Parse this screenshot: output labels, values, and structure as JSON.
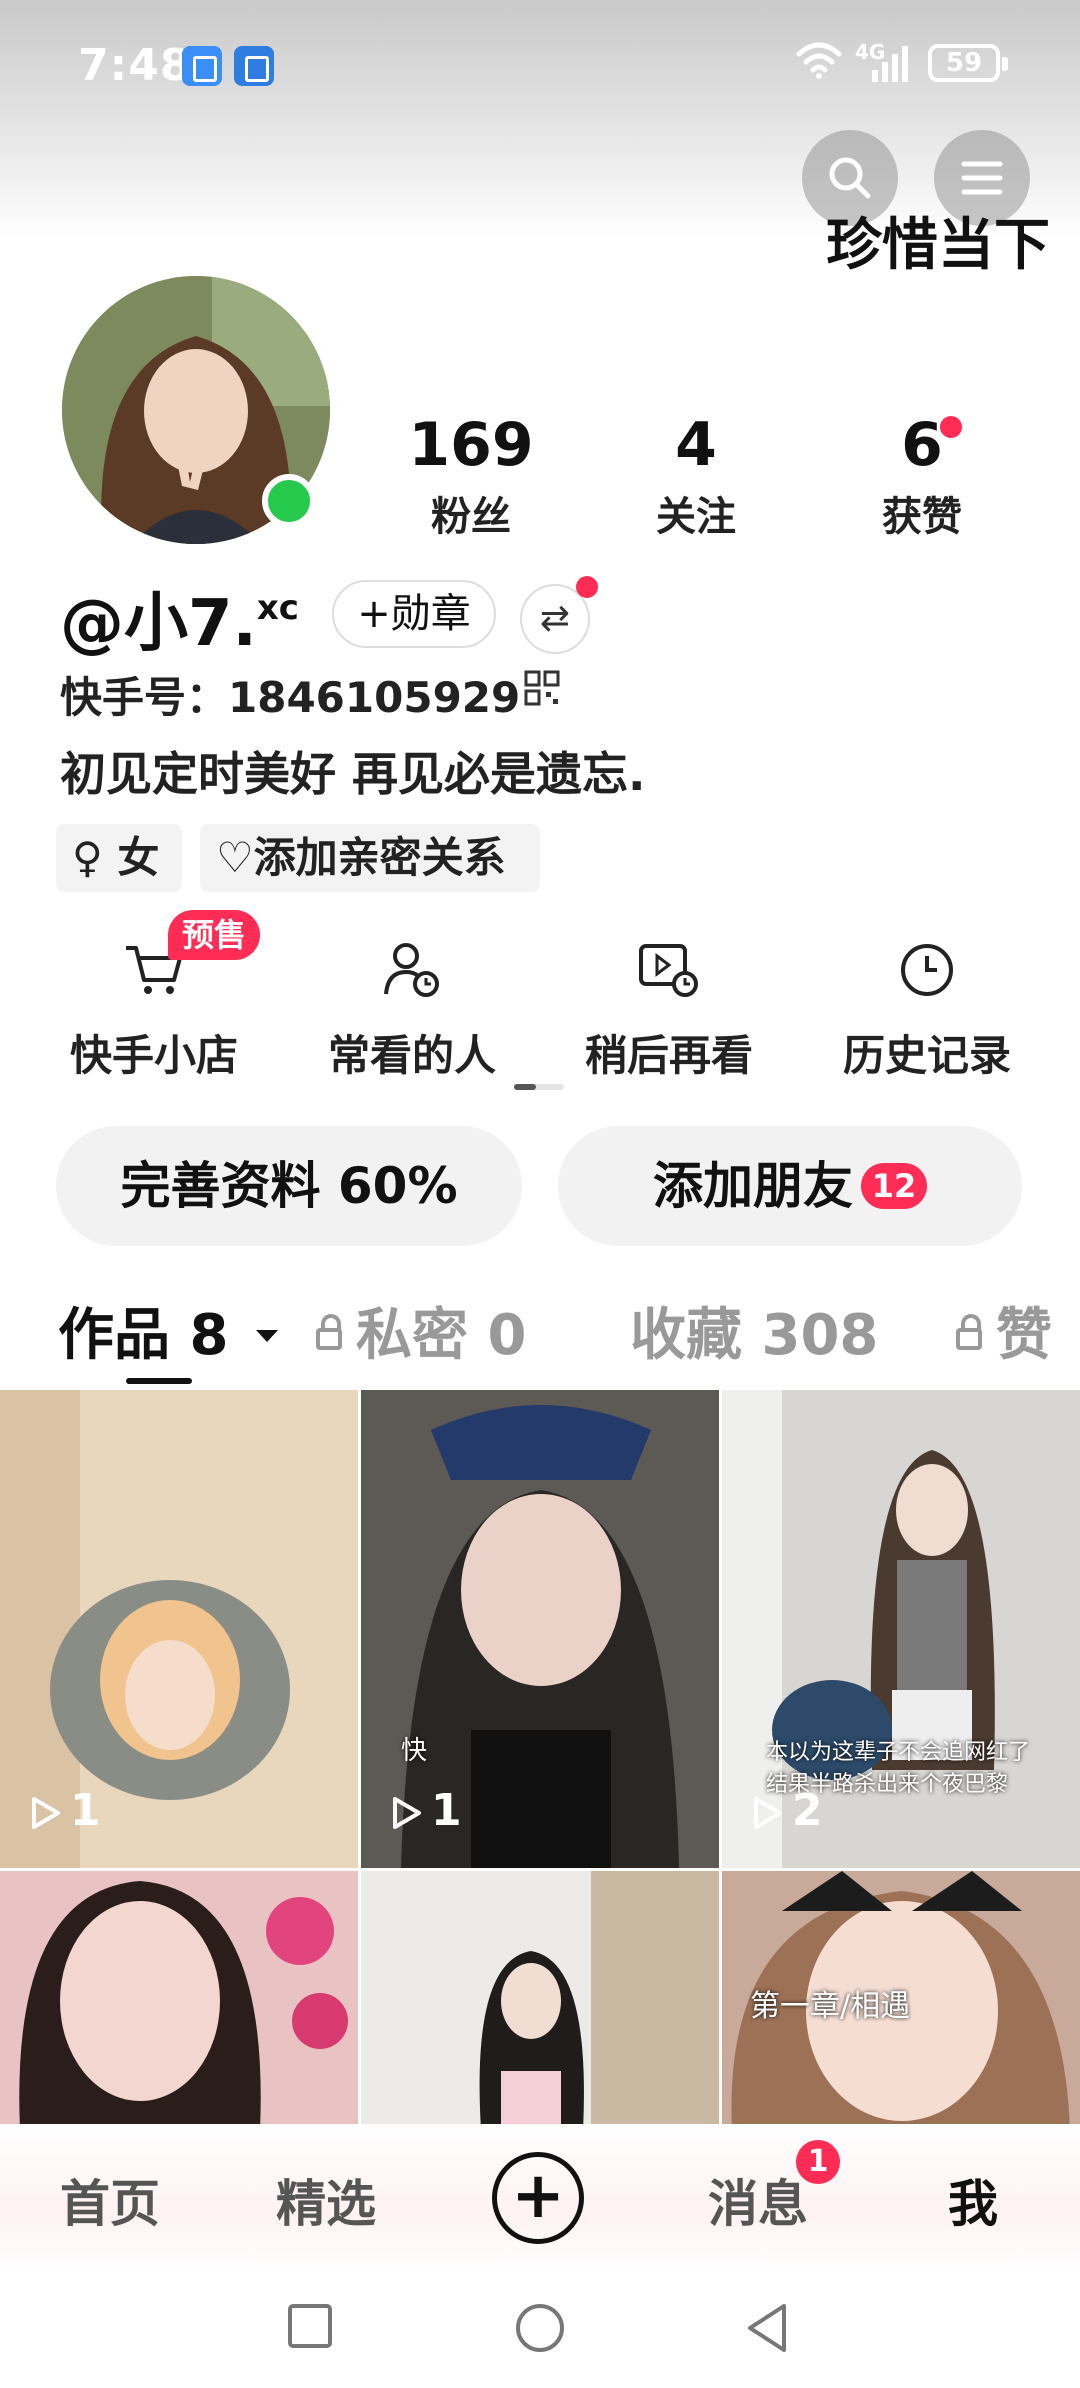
{
  "status_bar": {
    "time": "7:48",
    "network": "4G",
    "battery": "59"
  },
  "header": {
    "overlay_text": "珍惜当下"
  },
  "profile": {
    "handle": "@小7.",
    "handle_sup": "xc",
    "medal_label": "+勋章",
    "kuaishou_id": "快手号：1846105929",
    "bio": "初见定时美好 再见必是遗忘.",
    "tags": [
      "♀ 女",
      "♡添加亲密关系"
    ]
  },
  "stats": [
    {
      "value": "169",
      "label": "粉丝"
    },
    {
      "value": "4",
      "label": "关注"
    },
    {
      "value": "6",
      "label": "获赞"
    }
  ],
  "shortcuts": [
    {
      "label": "快手小店",
      "icon": "cart-icon"
    },
    {
      "label": "常看的人",
      "icon": "person-clock-icon"
    },
    {
      "label": "稍后再看",
      "icon": "play-clock-icon"
    },
    {
      "label": "历史记录",
      "icon": "clock-icon"
    }
  ],
  "presale_badge": "预售",
  "actions": {
    "complete_profile": "完善资料 60%",
    "add_friends": "添加朋友",
    "add_friends_count": "12"
  },
  "tabs": [
    {
      "label": "作品 8",
      "active": true
    },
    {
      "label": "私密 0",
      "locked": true
    },
    {
      "label": "收藏 308"
    },
    {
      "label": "赞",
      "locked": true
    }
  ],
  "videos": [
    {
      "plays": "1"
    },
    {
      "plays": "1",
      "caption": "快"
    },
    {
      "plays": "2",
      "caption": "本以为这辈子不会追网红了\n结果半路杀出来个夜巴黎"
    },
    {
      "plays": ""
    },
    {
      "plays": ""
    },
    {
      "plays": "",
      "caption": "第一章/相遇"
    }
  ],
  "nav": {
    "home": "首页",
    "featured": "精选",
    "messages": "消息",
    "messages_badge": "1",
    "me": "我"
  },
  "colors": {
    "accent": "#ff2d55",
    "online": "#25c94b"
  }
}
